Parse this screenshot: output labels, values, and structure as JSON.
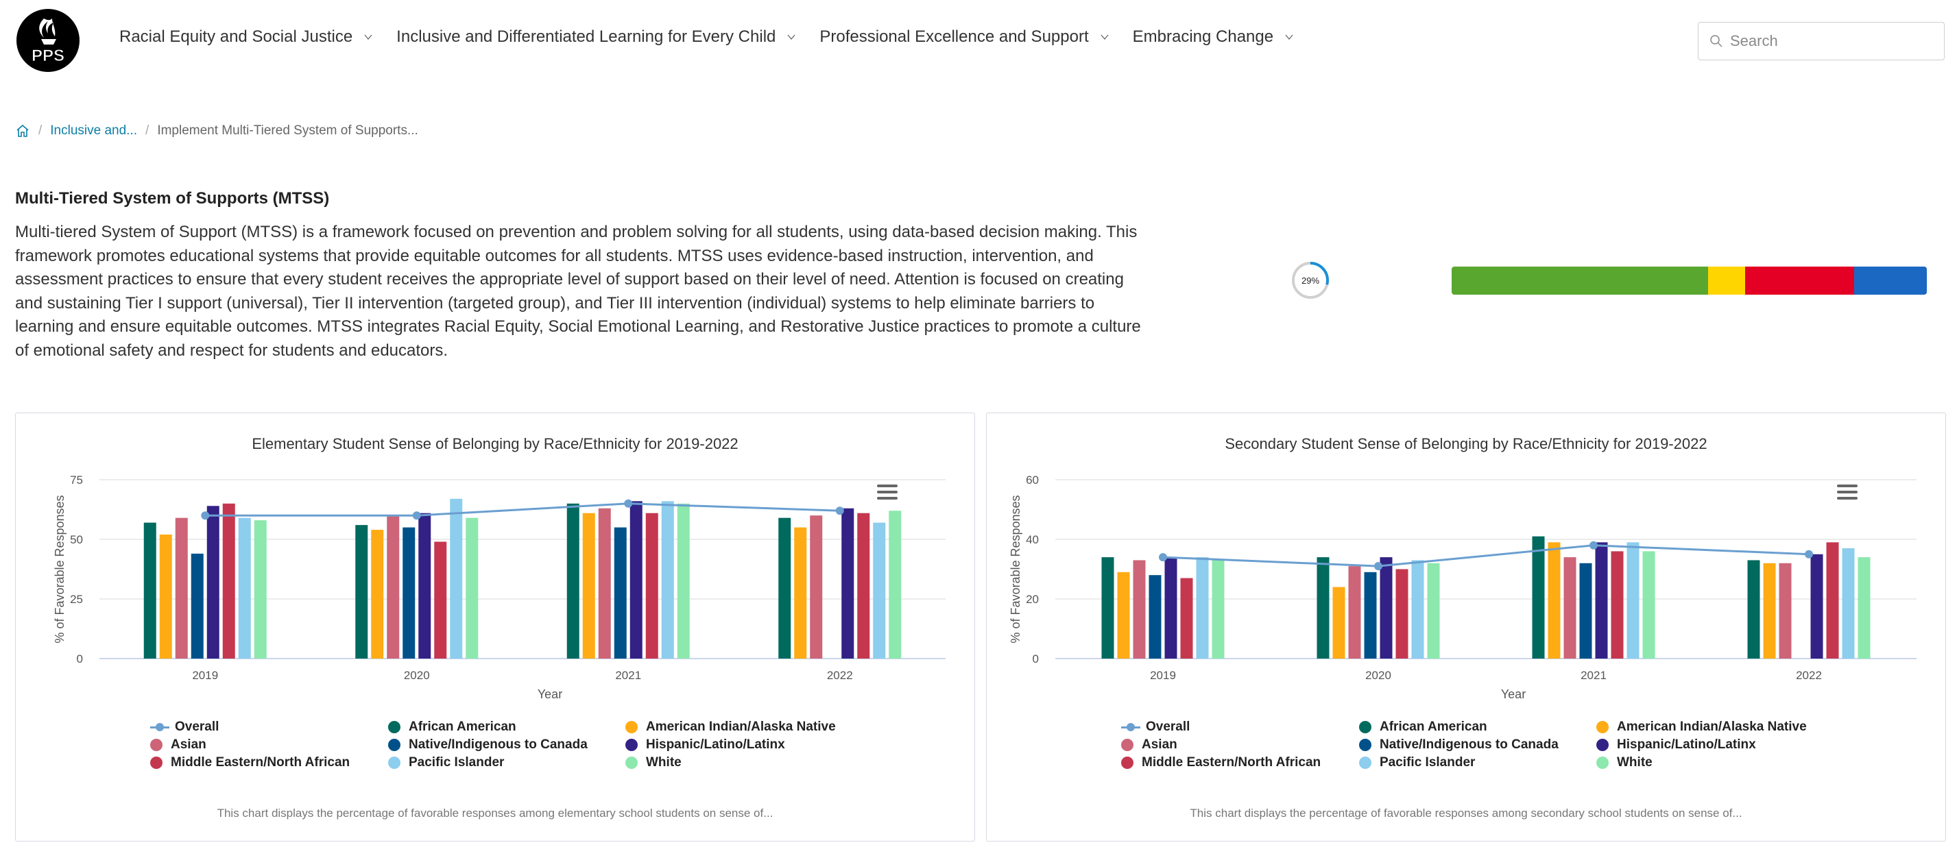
{
  "header": {
    "logo_text": "PPS",
    "nav": [
      {
        "label": "Racial Equity and Social Justice",
        "icon": "chevron-down-icon"
      },
      {
        "label": "Inclusive and Differentiated Learning for Every Child",
        "icon": "chevron-down-icon"
      },
      {
        "label": "Professional Excellence and Support",
        "icon": "chevron-down-icon"
      },
      {
        "label": "Embracing Change",
        "icon": "chevron-down-icon"
      }
    ],
    "search": {
      "placeholder": "Search",
      "value": "",
      "icon": "search-icon"
    }
  },
  "breadcrumb": {
    "home_icon": "home-icon",
    "items": [
      {
        "label": "Inclusive and..."
      },
      {
        "label": "Implement Multi-Tiered System of Supports..."
      }
    ],
    "separator": "/"
  },
  "intro": {
    "title": "Multi-Tiered System of Supports (MTSS)",
    "description": "Multi-tiered System of Support (MTSS) is a framework focused on prevention and problem solving for all students, using data-based decision making. This framework promotes educational systems that provide equitable outcomes for all students. MTSS uses evidence-based instruction, intervention, and assessment practices to ensure that every student receives the appropriate level of support based on their level of need. Attention is focused on creating and sustaining Tier I support (universal), Tier II intervention (targeted group), and Tier III intervention (individual) systems to help eliminate barriers to learning and ensure equitable outcomes. MTSS integrates Racial Equity, Social Emotional Learning, and Restorative Justice practices to promote a culture of emotional safety and respect for students and educators."
  },
  "progress": {
    "ring_label": "29%",
    "ring_value": 0.29,
    "ring_color": "#1a8fd6",
    "ring_track_color": "#d0d0d0",
    "status_segments": [
      {
        "name": "green",
        "color": "#5aa72f",
        "fraction": 0.54
      },
      {
        "name": "yellow",
        "color": "#ffd500",
        "fraction": 0.077
      },
      {
        "name": "red",
        "color": "#e30024",
        "fraction": 0.23
      },
      {
        "name": "blue",
        "color": "#1b68c2",
        "fraction": 0.153
      }
    ]
  },
  "colors": {
    "Overall": "#6a9fd0",
    "African American": "#006a5e",
    "American Indian/Alaska Native": "#ffab14",
    "Asian": "#cd6477",
    "Native/Indigenous to Canada": "#00518a",
    "Hispanic/Latino/Latinx": "#332186",
    "Middle Eastern/North African": "#c5374f",
    "Pacific Islander": "#8dcdee",
    "White": "#8ce8ad"
  },
  "legend_order": [
    "Overall",
    "African American",
    "American Indian/Alaska Native",
    "Asian",
    "Native/Indigenous to Canada",
    "Hispanic/Latino/Latinx",
    "Middle Eastern/North African",
    "Pacific Islander",
    "White"
  ],
  "chart_data": [
    {
      "type": "bar",
      "title": "Elementary Student Sense of Belonging by Race/Ethnicity for 2019-2022",
      "xlabel": "Year",
      "ylabel": "% of Favorable Responses",
      "categories": [
        "2019",
        "2020",
        "2021",
        "2022"
      ],
      "ylim": [
        0,
        75
      ],
      "yticks": [
        0,
        25,
        50,
        75
      ],
      "grid": true,
      "legend": "bottom",
      "menu_icon": "hamburger-menu-icon",
      "footnote": "This chart displays the percentage of favorable responses among elementary school students on sense of...",
      "series": [
        {
          "name": "African American",
          "type": "bar",
          "values": [
            57,
            56,
            65,
            59
          ]
        },
        {
          "name": "American Indian/Alaska Native",
          "type": "bar",
          "values": [
            52,
            54,
            61,
            55
          ]
        },
        {
          "name": "Asian",
          "type": "bar",
          "values": [
            59,
            60,
            63,
            60
          ]
        },
        {
          "name": "Native/Indigenous to Canada",
          "type": "bar",
          "values": [
            44,
            55,
            55,
            null
          ]
        },
        {
          "name": "Hispanic/Latino/Latinx",
          "type": "bar",
          "values": [
            64,
            61,
            66,
            63
          ]
        },
        {
          "name": "Middle Eastern/North African",
          "type": "bar",
          "values": [
            65,
            49,
            61,
            61
          ]
        },
        {
          "name": "Pacific Islander",
          "type": "bar",
          "values": [
            59,
            67,
            66,
            57
          ]
        },
        {
          "name": "White",
          "type": "bar",
          "values": [
            58,
            59,
            65,
            62
          ]
        },
        {
          "name": "Overall",
          "type": "line",
          "values": [
            60,
            60,
            65,
            62
          ]
        }
      ]
    },
    {
      "type": "bar",
      "title": "Secondary Student Sense of Belonging by Race/Ethnicity for 2019-2022",
      "xlabel": "Year",
      "ylabel": "% of Favorable Responses",
      "categories": [
        "2019",
        "2020",
        "2021",
        "2022"
      ],
      "ylim": [
        0,
        60
      ],
      "yticks": [
        0,
        20,
        40,
        60
      ],
      "grid": true,
      "legend": "bottom",
      "menu_icon": "hamburger-menu-icon",
      "footnote": "This chart displays the percentage of favorable responses among secondary school students on sense of...",
      "series": [
        {
          "name": "African American",
          "type": "bar",
          "values": [
            34,
            34,
            41,
            33
          ]
        },
        {
          "name": "American Indian/Alaska Native",
          "type": "bar",
          "values": [
            29,
            24,
            39,
            32
          ]
        },
        {
          "name": "Asian",
          "type": "bar",
          "values": [
            33,
            31,
            34,
            32
          ]
        },
        {
          "name": "Native/Indigenous to Canada",
          "type": "bar",
          "values": [
            28,
            29,
            32,
            null
          ]
        },
        {
          "name": "Hispanic/Latino/Latinx",
          "type": "bar",
          "values": [
            34,
            34,
            39,
            35
          ]
        },
        {
          "name": "Middle Eastern/North African",
          "type": "bar",
          "values": [
            27,
            30,
            36,
            39
          ]
        },
        {
          "name": "Pacific Islander",
          "type": "bar",
          "values": [
            34,
            33,
            39,
            37
          ]
        },
        {
          "name": "White",
          "type": "bar",
          "values": [
            33,
            32,
            36,
            34
          ]
        },
        {
          "name": "Overall",
          "type": "line",
          "values": [
            34,
            31,
            38,
            35
          ]
        }
      ]
    }
  ]
}
